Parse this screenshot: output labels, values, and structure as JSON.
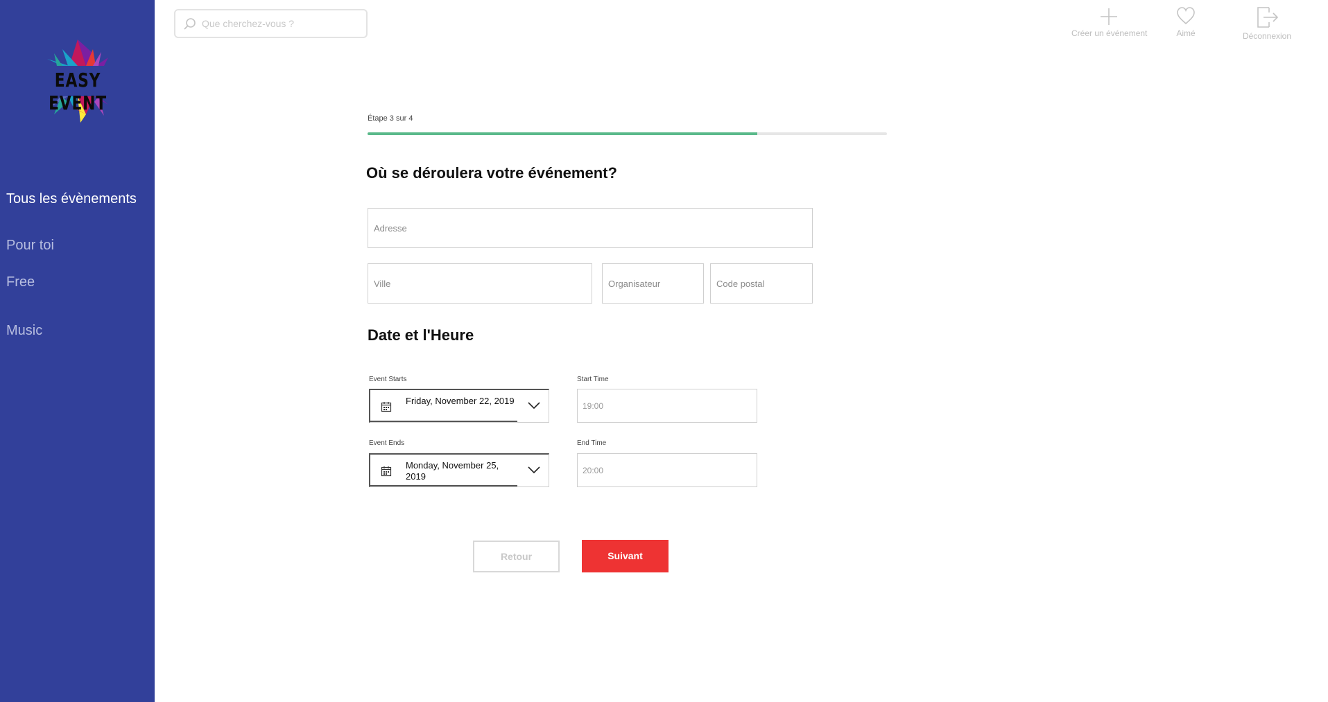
{
  "brand": {
    "logo_text": "EASY EVENT",
    "sidebar_color": "#32409a"
  },
  "sidebar": {
    "items": [
      {
        "label": "Tous les évènements",
        "active": true
      },
      {
        "label": "Pour toi",
        "active": false
      },
      {
        "label": "Free",
        "active": false
      },
      {
        "label": "Music",
        "active": false
      }
    ]
  },
  "search": {
    "placeholder": "Que cherchez-vous ?",
    "value": ""
  },
  "header_actions": {
    "create": {
      "label": "Créer un événement",
      "icon": "plus-icon"
    },
    "liked": {
      "label": "Aimé",
      "icon": "heart-icon"
    },
    "logout": {
      "label": "Déconnexion",
      "icon": "logout-icon"
    }
  },
  "progress": {
    "label": "Étape 3 sur 4",
    "fraction": 0.75,
    "color": "#5ab98a"
  },
  "location": {
    "title": "Où se déroulera votre événement?",
    "address_placeholder": "Adresse",
    "city_placeholder": "Ville",
    "organizer_placeholder": "Organisateur",
    "postal_placeholder": "Code postal"
  },
  "datetime": {
    "title": "Date et l'Heure",
    "event_starts_label": "Event Starts",
    "event_starts_value": "Friday, November 22, 2019",
    "start_time_label": "Start Time",
    "start_time_value": "19:00",
    "event_ends_label": "Event Ends",
    "event_ends_value": "Monday, November 25, 2019",
    "end_time_label": "End  Time",
    "end_time_value": "20:00"
  },
  "buttons": {
    "back": "Retour",
    "next": "Suivant",
    "next_color": "#ee3333"
  }
}
